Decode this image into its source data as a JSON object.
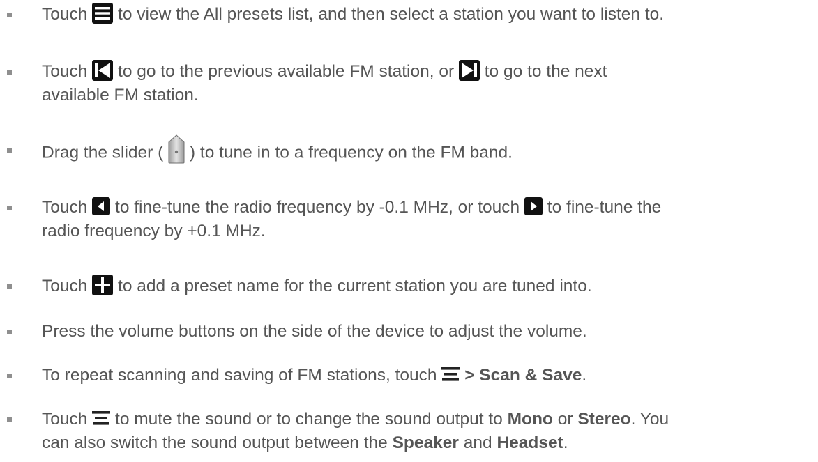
{
  "items": [
    {
      "a": "Touch",
      "b": "to view the All presets list, and then select a station you want to listen to."
    },
    {
      "a": "Touch",
      "b": "to go to the previous available FM station, or",
      "c": "to go to the next",
      "d": "available FM station."
    },
    {
      "a": "Drag the slider (",
      "b": ") to tune in to a frequency on the FM band."
    },
    {
      "a": "Touch",
      "b": "to fine-tune the radio frequency by -0.1 MHz, or touch",
      "c": "to fine-tune the",
      "d": "radio frequency by +0.1 MHz."
    },
    {
      "a": "Touch",
      "b": "to add a preset name for the current station you are tuned into."
    },
    {
      "a": "Press the volume buttons on the side of the device to adjust the volume."
    },
    {
      "a": "To repeat scanning and saving of FM stations, touch",
      "b": "> Scan & Save",
      "c": "."
    },
    {
      "a": "Touch",
      "b": "to mute the sound or to change the sound output to",
      "mono": "Mono",
      "or": "or",
      "stereo": "Stereo",
      "c": ". You",
      "d": "can also switch the sound output between the",
      "speaker": "Speaker",
      "and": "and",
      "headset": "Headset",
      "e": "."
    }
  ],
  "icons": {
    "presets_list": "list-icon",
    "previous_station": "previous-station-icon",
    "next_station": "next-station-icon",
    "slider": "slider-handle-icon",
    "fine_tune_down": "arrow-left-icon",
    "fine_tune_up": "arrow-right-icon",
    "add_preset": "plus-icon",
    "menu": "menu-icon"
  },
  "colors": {
    "text": "#555555",
    "bullet": "#8f8f8f",
    "icon_bg": "#111111",
    "icon_fg": "#ffffff"
  }
}
